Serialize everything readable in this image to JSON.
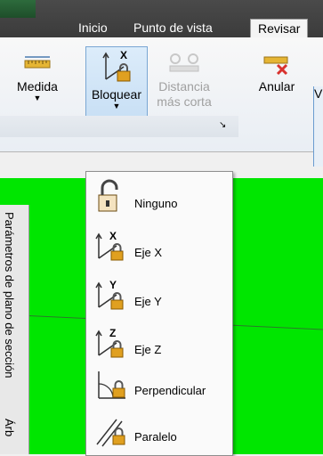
{
  "tabs": {
    "inicio": "Inicio",
    "punto_de_vista": "Punto de vista",
    "revisar": "Revisar"
  },
  "ribbon": {
    "medida": "Medida",
    "bloquear": "Bloquear",
    "distancia_line1": "Distancia",
    "distancia_line2": "más corta",
    "anular": "Anular",
    "right_cut_label": "V"
  },
  "dropdown_items": [
    {
      "label": "Ninguno",
      "icon": "open-padlock-icon"
    },
    {
      "label": "Eje X",
      "icon": "x-axis-lock-icon"
    },
    {
      "label": "Eje Y",
      "icon": "y-axis-lock-icon"
    },
    {
      "label": "Eje Z",
      "icon": "z-axis-lock-icon"
    },
    {
      "label": "Perpendicular",
      "icon": "perpendicular-lock-icon"
    },
    {
      "label": "Paralelo",
      "icon": "parallel-lock-icon"
    }
  ],
  "side_panel": {
    "tab1": "Parámetros de plano de sección",
    "tab2": "Árb"
  },
  "colors": {
    "viewport": "#00e600",
    "accent": "#7aa7d3",
    "lock": "#e0a020"
  }
}
